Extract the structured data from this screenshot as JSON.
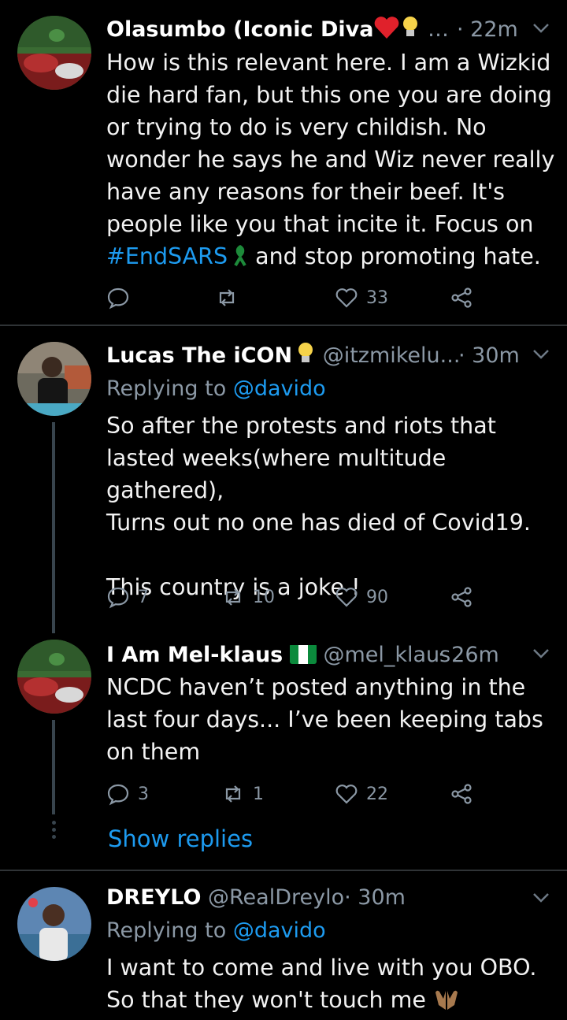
{
  "tweets": [
    {
      "name": "Olasumbo (Iconic Diva",
      "handle": "…",
      "time": "· 22m",
      "body_before": "How is this relevant here. I am a Wizkid die hard fan, but this one you are doing or trying to do is very childish. No wonder he says he and Wiz never really have any reasons for their beef. It's people like you that incite it. Focus on ",
      "hashtag": "#EndSARS",
      "body_after": " and stop promoting hate.",
      "reply_count": "",
      "retweet_count": "",
      "like_count": "33"
    },
    {
      "name": "Lucas The iCON",
      "handle": "@itzmikelu...",
      "time": "· 30m",
      "replying_label": "Replying to",
      "replying_handle": "@davido",
      "body": "So after the protests and riots that lasted weeks(where multitude gathered),\nTurns out no one has died of Covid19.\n\nThis country is a joke !",
      "reply_count": "7",
      "retweet_count": "10",
      "like_count": "90"
    },
    {
      "name": "I Am Mel-klaus",
      "handle": "@mel_klaus",
      "time": "· 26m",
      "body": "NCDC haven’t posted anything in the last four days... I’ve been keeping tabs on them",
      "reply_count": "3",
      "retweet_count": "1",
      "like_count": "22",
      "show_replies": "Show replies"
    },
    {
      "name": "DREYLO",
      "handle": "@RealDreylo",
      "time": "· 30m",
      "replying_label": "Replying to",
      "replying_handle": "@davido",
      "body": "I want to come and live with you OBO. So that they won't touch me"
    }
  ],
  "colors": {
    "link": "#1d9bf0",
    "muted": "#8b98a5",
    "divider": "#2f3336"
  }
}
